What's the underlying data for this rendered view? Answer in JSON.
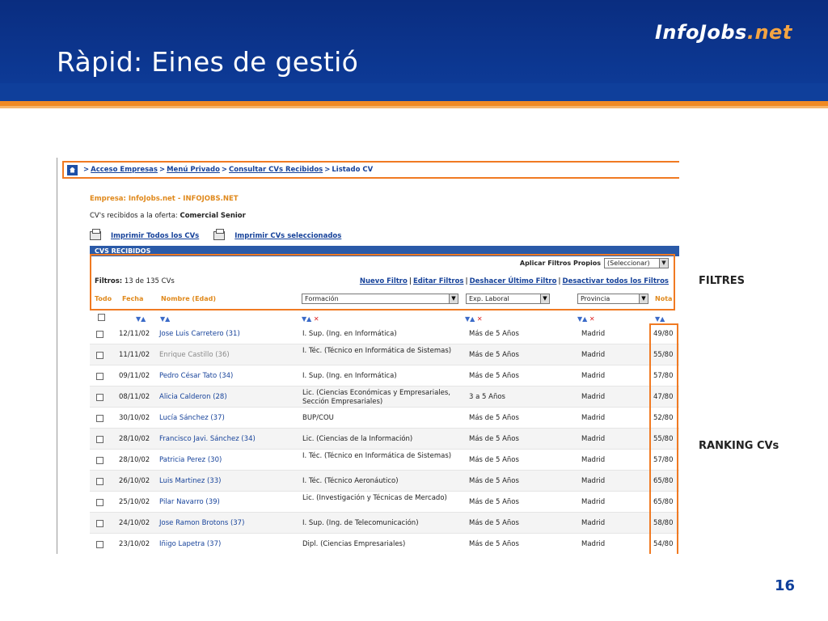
{
  "slide": {
    "title": "Ràpid: Eines de gestió",
    "logo_main": "InfoJobs",
    "logo_dot": ".",
    "logo_net": "net",
    "label_filtres": "FILTRES",
    "label_ranking": "RANKING CVs",
    "page_number": "16"
  },
  "colors": {
    "header": "#0d3a96",
    "accent": "#f08a24",
    "link": "#16429a"
  },
  "breadcrumb": {
    "items": [
      "Acceso Empresas",
      "Menú Privado",
      "Consultar CVs Recibidos"
    ],
    "current": "Listado CV",
    "separator": ">"
  },
  "company": "Empresa: InfoJobs.net - INFOJOBS.NET",
  "offer_prefix": "CV's recibidos a la oferta: ",
  "offer_name": "Comercial Senior",
  "print": {
    "all": "Imprimir Todos los CVs",
    "selected": "Imprimir CVs seleccionados"
  },
  "panel_title": "CVS RECIBIDOS",
  "filters": {
    "own_label": "Aplicar Filtros Propios",
    "own_select": "(Seleccionar)",
    "count_label": "Filtros:",
    "count_value": "13 de 135 CVs",
    "links": [
      "Nuevo Filtro",
      "Editar Filtros",
      "Deshacer Último Filtro",
      "Desactivar todos los Filtros"
    ]
  },
  "columns": {
    "todo": "Todo",
    "fecha": "Fecha",
    "nombre": "Nombre (Edad)",
    "formacion": "Formación",
    "experiencia": "Exp. Laboral",
    "provincia": "Provincia",
    "nota": "Nota"
  },
  "rows": [
    {
      "date": "12/11/02",
      "name": "Jose Luis Carretero (31)",
      "formation": "I. Sup. (Ing. en Informática)",
      "experience": "Más de 5 Años",
      "province": "Madrid",
      "score": "49/80"
    },
    {
      "date": "11/11/02",
      "name": "Enrique Castillo (36)",
      "formation": "I. Téc. (Técnico en Informática de Sistemas)",
      "experience": "Más de 5 Años",
      "province": "Madrid",
      "score": "55/80"
    },
    {
      "date": "09/11/02",
      "name": "Pedro César Tato (34)",
      "formation": "I. Sup. (Ing. en Informática)",
      "experience": "Más de 5 Años",
      "province": "Madrid",
      "score": "57/80"
    },
    {
      "date": "08/11/02",
      "name": "Alicia Calderon (28)",
      "formation": "Lic. (Ciencias Económicas y Empresariales, Sección Empresariales)",
      "experience": "3 a 5 Años",
      "province": "Madrid",
      "score": "47/80"
    },
    {
      "date": "30/10/02",
      "name": "Lucía Sánchez (37)",
      "formation": "BUP/COU",
      "experience": "Más de 5 Años",
      "province": "Madrid",
      "score": "52/80"
    },
    {
      "date": "28/10/02",
      "name": "Francisco Javi. Sánchez (34)",
      "formation": "Lic. (Ciencias de la Información)",
      "experience": "Más de 5 Años",
      "province": "Madrid",
      "score": "55/80"
    },
    {
      "date": "28/10/02",
      "name": "Patricia Perez (30)",
      "formation": "I. Téc. (Técnico en Informática de Sistemas)",
      "experience": "Más de 5 Años",
      "province": "Madrid",
      "score": "57/80"
    },
    {
      "date": "26/10/02",
      "name": "Luis Martinez (33)",
      "formation": "I. Téc. (Técnico Aeronáutico)",
      "experience": "Más de 5 Años",
      "province": "Madrid",
      "score": "65/80"
    },
    {
      "date": "25/10/02",
      "name": "Pilar Navarro (39)",
      "formation": "Lic. (Investigación y Técnicas de Mercado)",
      "experience": "Más de 5 Años",
      "province": "Madrid",
      "score": "65/80"
    },
    {
      "date": "24/10/02",
      "name": "Jose Ramon Brotons (37)",
      "formation": "I. Sup. (Ing. de Telecomunicación)",
      "experience": "Más de 5 Años",
      "province": "Madrid",
      "score": "58/80"
    },
    {
      "date": "23/10/02",
      "name": "Iñigo Lapetra (37)",
      "formation": "Dipl. (Ciencias Empresariales)",
      "experience": "Más de 5 Años",
      "province": "Madrid",
      "score": "54/80"
    }
  ]
}
